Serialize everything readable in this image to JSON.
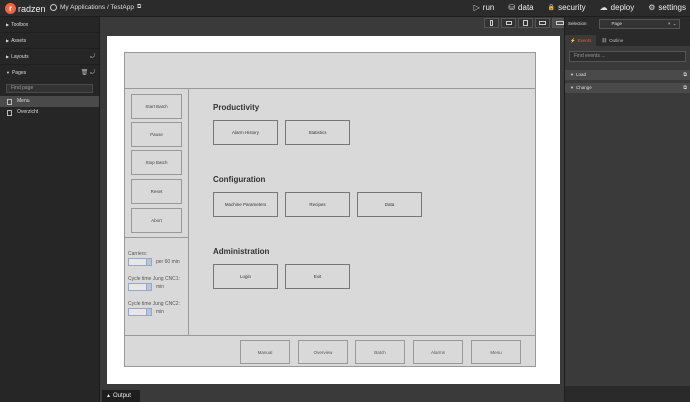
{
  "app": {
    "logo_mark": "r",
    "logo_text": "radzen",
    "breadcrumb": "My Applications / TestApp"
  },
  "topnav": [
    {
      "icon": "play-icon",
      "glyph": "▷",
      "label": "run"
    },
    {
      "icon": "database-icon",
      "glyph": "⛁",
      "label": "data"
    },
    {
      "icon": "lock-icon",
      "glyph": "🔒",
      "label": "security"
    },
    {
      "icon": "cloud-icon",
      "glyph": "☁",
      "label": "deploy"
    },
    {
      "icon": "gear-icon",
      "glyph": "⚙",
      "label": "settings"
    }
  ],
  "sidebar": {
    "sections": [
      "Toolbox",
      "Assets",
      "Layouts",
      "Pages"
    ],
    "find_placeholder": "Find page",
    "pages": [
      {
        "label": "Menu",
        "selected": true
      },
      {
        "label": "Overzicht",
        "selected": false
      }
    ]
  },
  "canvas": {
    "left_buttons": [
      "Start Batch",
      "Pause",
      "Stop Batch",
      "Reset",
      "Abort"
    ],
    "fields": [
      {
        "label": "Carriers:",
        "unit": "per 60 min"
      },
      {
        "label": "Cycle time Jung CNC1:",
        "unit": "min"
      },
      {
        "label": "Cycle time Jung CNC2:",
        "unit": "min"
      }
    ],
    "sections": [
      {
        "title": "Productivity",
        "buttons": [
          "Alarm History",
          "Statistics"
        ]
      },
      {
        "title": "Configuration",
        "buttons": [
          "Machine Parameters",
          "Recipes",
          "Data"
        ]
      },
      {
        "title": "Administration",
        "buttons": [
          "Login",
          "Exit"
        ]
      }
    ],
    "footer_buttons": [
      "Manual",
      "Overview",
      "Batch",
      "Alarms",
      "Menu"
    ]
  },
  "right_panel": {
    "selection_label": "Selection",
    "selection_value": "Page",
    "tabs": [
      "Events",
      "Outline"
    ],
    "find_events_placeholder": "Find events ...",
    "events": [
      "Load",
      "Change"
    ]
  },
  "output_label": "Output"
}
